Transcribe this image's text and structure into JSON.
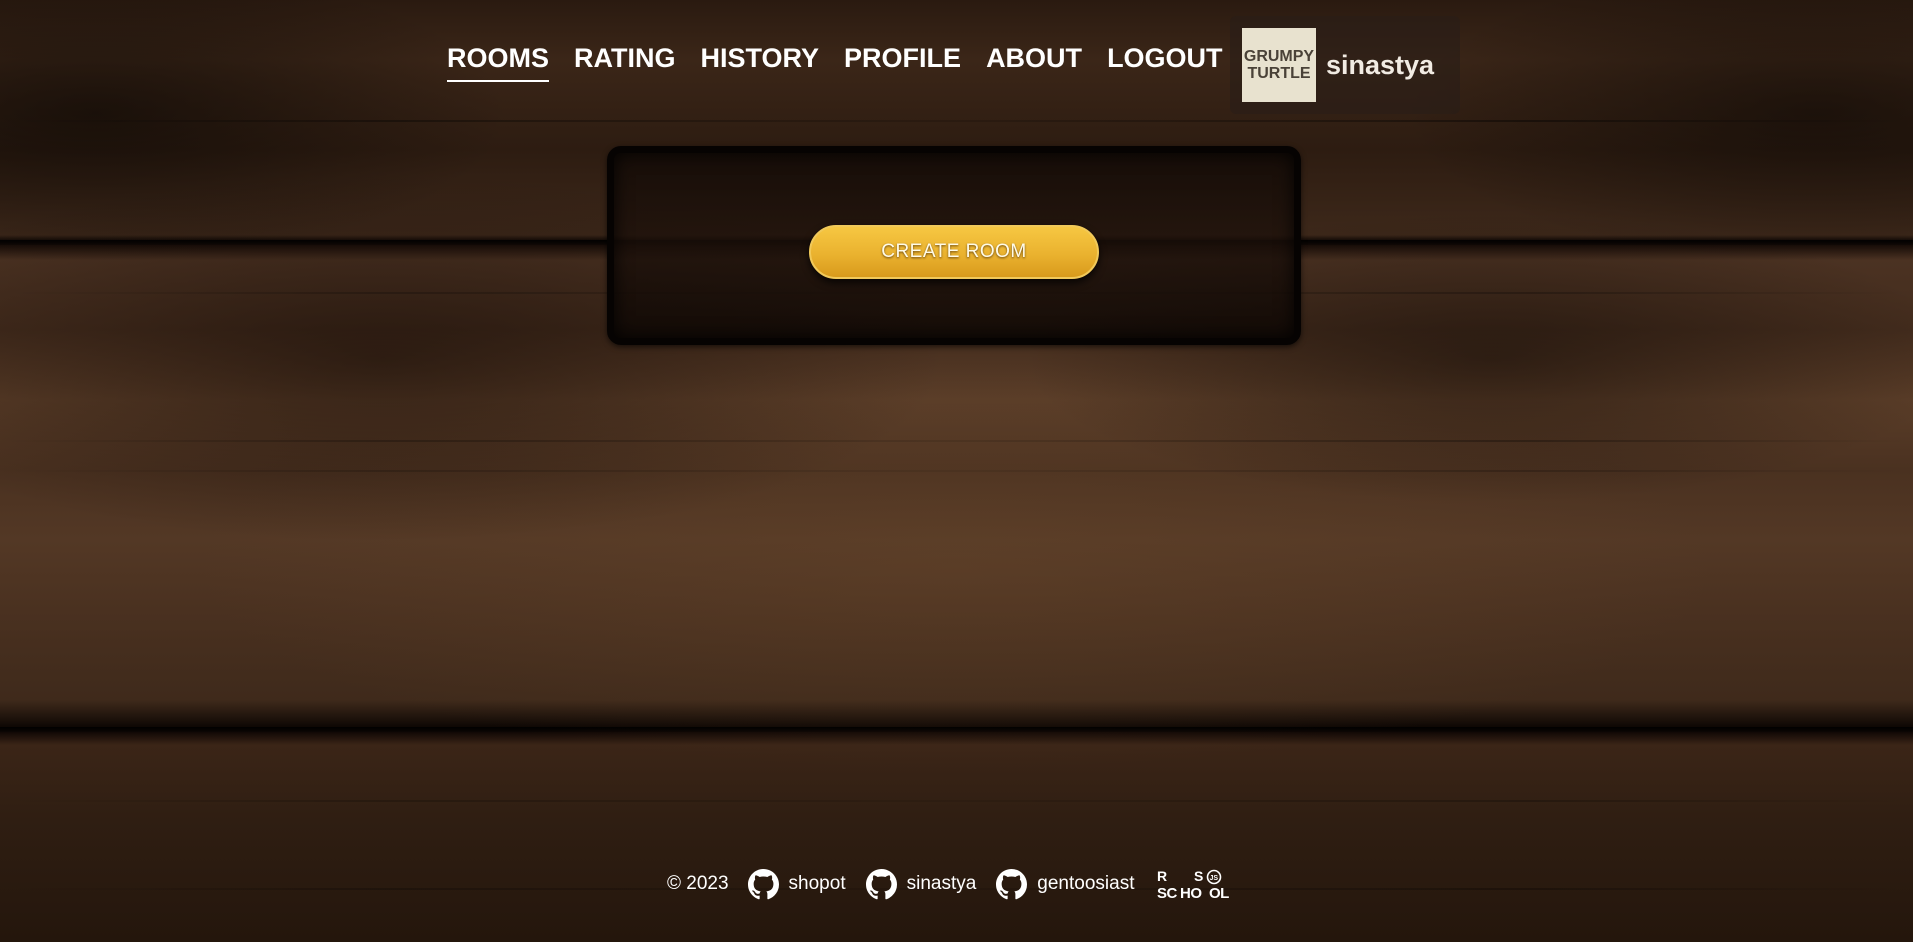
{
  "nav": {
    "items": [
      {
        "label": "ROOMS",
        "active": true
      },
      {
        "label": "RATING",
        "active": false
      },
      {
        "label": "HISTORY",
        "active": false
      },
      {
        "label": "PROFILE",
        "active": false
      },
      {
        "label": "ABOUT",
        "active": false
      },
      {
        "label": "LOGOUT",
        "active": false
      }
    ]
  },
  "user": {
    "avatar_line1": "GRUMPY",
    "avatar_line2": "TURTLE",
    "name": "sinastya"
  },
  "main": {
    "create_room_label": "CREATE ROOM"
  },
  "footer": {
    "copyright": "© 2023",
    "links": [
      {
        "icon": "github-icon",
        "label": "shopot"
      },
      {
        "icon": "github-icon",
        "label": "sinastya"
      },
      {
        "icon": "github-icon",
        "label": "gentoosiast"
      }
    ],
    "school_logo": "RS School"
  },
  "colors": {
    "accent": "#f0bb36",
    "accent_border": "#f1c95a",
    "panel_border": "#060302",
    "text": "#ffffff"
  }
}
